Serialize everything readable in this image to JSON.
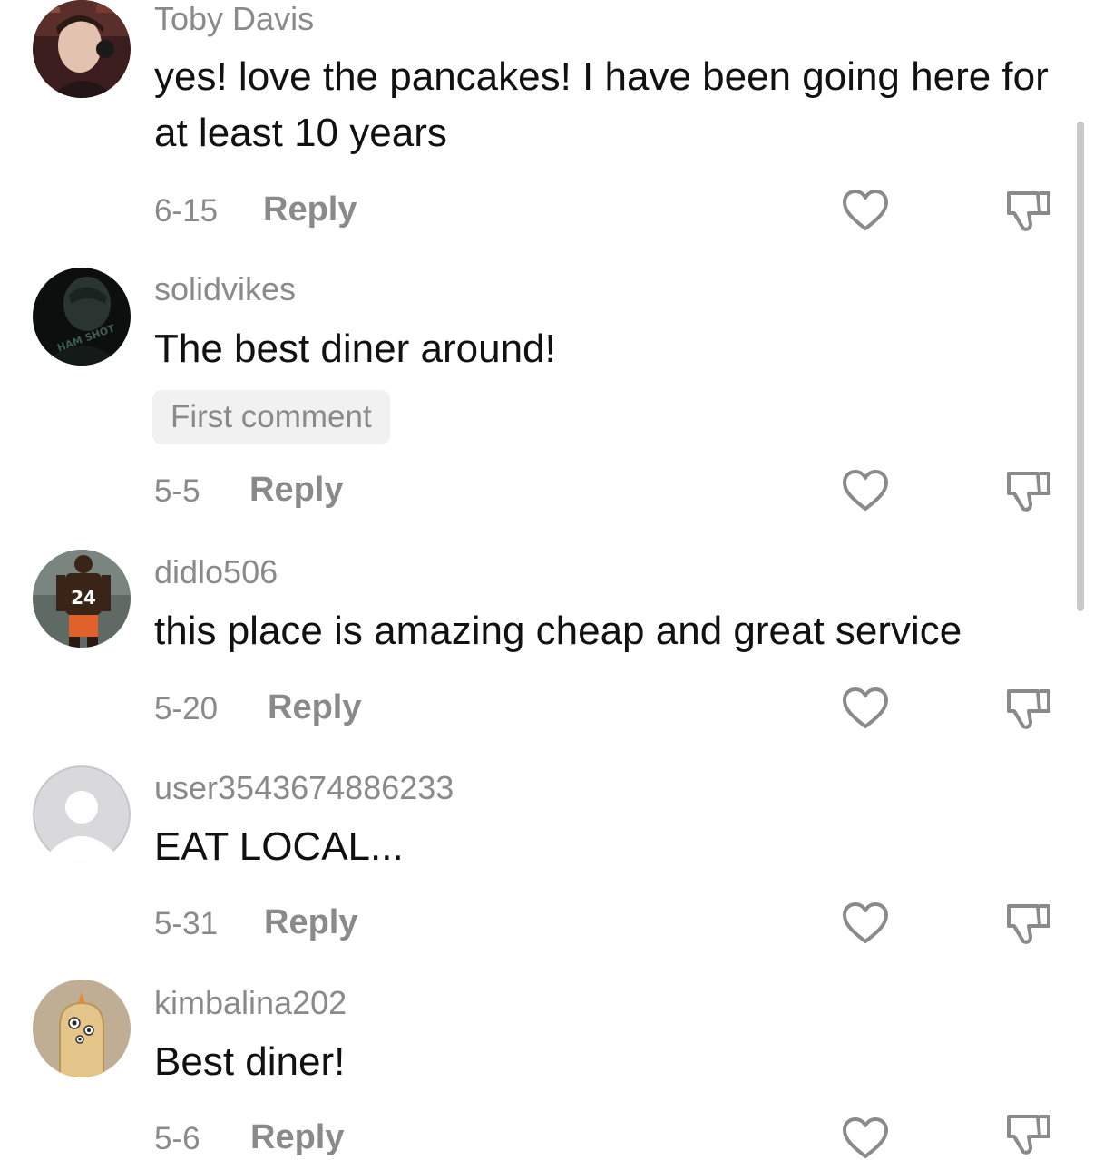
{
  "comments": [
    {
      "username": "Toby Davis",
      "text": "yes! love the pancakes! I have been going here for at least 10 years",
      "date": "6-15",
      "reply_label": "Reply",
      "badge": ""
    },
    {
      "username": "solidvikes",
      "text": "The best diner around!",
      "date": "5-5",
      "reply_label": "Reply",
      "badge": "First comment"
    },
    {
      "username": "didlo506",
      "text": "this place is amazing cheap and great service",
      "date": "5-20",
      "reply_label": "Reply",
      "badge": ""
    },
    {
      "username": "user3543674886233",
      "text": "EAT LOCAL...",
      "date": "5-31",
      "reply_label": "Reply",
      "badge": ""
    },
    {
      "username": "kimbalina202",
      "text": "Best diner!",
      "date": "5-6",
      "reply_label": "Reply",
      "badge": ""
    }
  ],
  "avatar_jersey_number": "24",
  "avatar_shirt_text": "HAM SHOT",
  "icons": {
    "like": "heart-icon",
    "dislike": "thumbs-down-icon"
  },
  "colors": {
    "text_primary": "#111111",
    "text_secondary": "#8a8a8a",
    "badge_bg": "#f1f1f2",
    "scrollbar": "#c9c9c9"
  }
}
